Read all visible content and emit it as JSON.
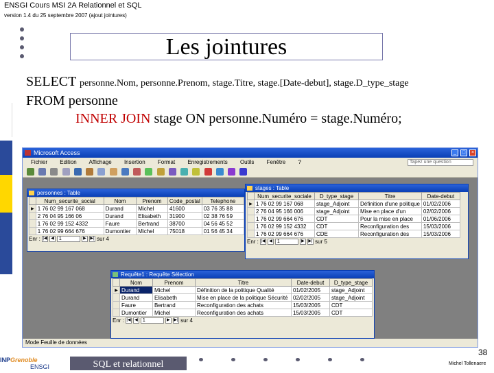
{
  "header": {
    "title": "ENSGI Cours MSI 2A Relationnel et SQL",
    "subtitle": "version 1.4 du 25 septembre 2007 (ajout jointures)"
  },
  "slide": {
    "title": "Les jointures",
    "sql": {
      "select_kw": "SELECT ",
      "select_cols": "personne.Nom, personne.Prenom, stage.Titre, stage.[Date-debut], stage.D_type_stage",
      "from_line": "FROM personne",
      "join_kw": "INNER JOIN",
      "join_rest": " stage ON personne.Numéro = stage.Numéro;"
    },
    "left_bar_colors": [
      "#ffffff",
      "#2a4a9a",
      "#ffd700",
      "#ffffff"
    ]
  },
  "access": {
    "window_title": "Microsoft Access",
    "menu": [
      "Fichier",
      "Edition",
      "Affichage",
      "Insertion",
      "Format",
      "Enregistrements",
      "Outils",
      "Fenêtre",
      "?"
    ],
    "help_placeholder": "Tapez une question",
    "status": "Mode Feuille de données",
    "personnes_table": {
      "title": "personnes : Table",
      "columns": [
        "Num_securite_social",
        "Nom",
        "Prenom",
        "Code_postal",
        "Telephone"
      ],
      "rows": [
        [
          "1 76 02 99 167 068",
          "Durand",
          "Michel",
          "41600",
          "03 76 35 88"
        ],
        [
          "2 76 04 95 166 06",
          "Durand",
          "Elisabeth",
          "31900",
          "02 38 76 59"
        ],
        [
          "1 76 02 99 152 4332",
          "Faure",
          "Bertrand",
          "38700",
          "04 56 45 52"
        ],
        [
          "1 76 02 99 664 676",
          "Dumontier",
          "Michel",
          "75018",
          "01 56 45 34"
        ]
      ],
      "nav_total": "sur 4"
    },
    "stages_table": {
      "title": "stages : Table",
      "columns": [
        "Num_securite_sociale",
        "D_type_stage",
        "Titre",
        "Date-debut"
      ],
      "rows": [
        [
          "1 76 02 99 167 068",
          "stage_Adjoint",
          "Définition d'une politique",
          "01/02/2006"
        ],
        [
          "2 76 04 95 166 006",
          "stage_Adjoint",
          "Mise en place d'un",
          "02/02/2006"
        ],
        [
          "1 76 02 99 664 676",
          "CDT",
          "Pour la mise en place",
          "01/06/2006"
        ],
        [
          "1 76 02 99 152 4332",
          "CDT",
          "Reconfiguration des",
          "15/03/2006"
        ],
        [
          "1 76 02 99 664 676",
          "CDE",
          "Reconfiguration des",
          "15/03/2006"
        ]
      ],
      "nav_total": "sur 5"
    },
    "query": {
      "title": "Requête1 : Requête Sélection",
      "columns": [
        "Nom",
        "Prenom",
        "Titre",
        "Date-debut",
        "D_type_stage"
      ],
      "rows": [
        [
          "Durand",
          "Michel",
          "Définition de la politique Qualité",
          "01/02/2005",
          "stage_Adjoint"
        ],
        [
          "Durand",
          "Elisabeth",
          "Mise en place de la politique Sécurité",
          "02/02/2005",
          "stage_Adjoint"
        ],
        [
          "Faure",
          "Bertrand",
          "Reconfiguration des achats",
          "15/03/2005",
          "CDT"
        ],
        [
          "Dumontier",
          "Michel",
          "Reconfiguration des achats",
          "15/03/2005",
          "CDT"
        ]
      ],
      "nav_total": "sur 4"
    },
    "nav_label": "Enr :",
    "nav_record": "1"
  },
  "footer": {
    "logo_main": "INP",
    "logo_accent": "Grenoble",
    "logo_sub": "ENSGI",
    "box": "SQL et relationnel",
    "page": "38",
    "author": "Michel Tollenaere"
  }
}
